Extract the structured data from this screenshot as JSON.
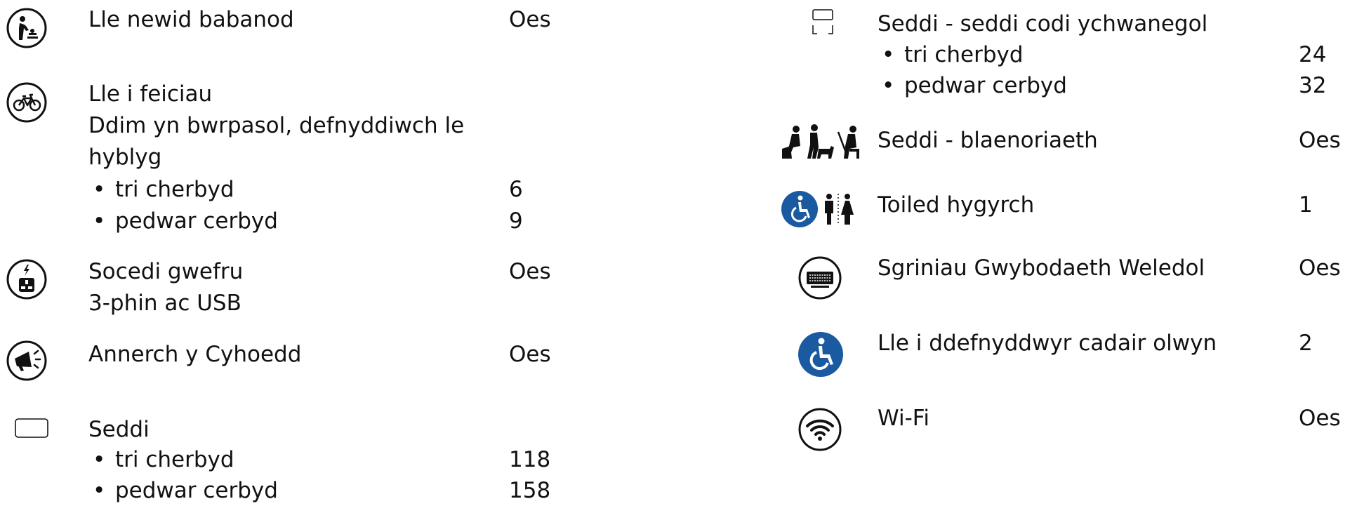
{
  "left": {
    "baby_change": {
      "label": "Lle newid babanod",
      "value": "Oes",
      "icon": "baby-change-icon"
    },
    "bicycle": {
      "label": "Lle i feiciau",
      "desc_line1": "Ddim yn bwrpasol, defnyddiwch le",
      "desc_line2": "hyblyg",
      "items": [
        {
          "label": "tri cherbyd",
          "value": "6"
        },
        {
          "label": "pedwar cerbyd",
          "value": "9"
        }
      ],
      "icon": "bicycle-icon"
    },
    "sockets": {
      "label": "Socedi gwefru",
      "desc": "3-phin ac USB",
      "value": "Oes",
      "icon": "plug-socket-icon"
    },
    "pa": {
      "label": "Annerch y Cyhoedd",
      "value": "Oes",
      "icon": "megaphone-icon"
    },
    "seats": {
      "label": "Seddi",
      "items": [
        {
          "label": "tri cherbyd",
          "value": "118"
        },
        {
          "label": "pedwar cerbyd",
          "value": "158"
        }
      ],
      "icon": "seat-icon"
    }
  },
  "right": {
    "tipup": {
      "label": "Seddi - seddi codi ychwanegol",
      "items": [
        {
          "label": "tri cherbyd",
          "value": "24"
        },
        {
          "label": "pedwar cerbyd",
          "value": "32"
        }
      ],
      "icon": "tip-up-seat-icon"
    },
    "priority": {
      "label": "Seddi - blaenoriaeth",
      "value": "Oes",
      "icon": "priority-seat-icon"
    },
    "toilet": {
      "label": "Toiled hygyrch",
      "value": "1",
      "icon": "accessible-toilet-icon"
    },
    "screens": {
      "label": "Sgriniau Gwybodaeth Weledol",
      "value": "Oes",
      "icon": "info-screen-icon"
    },
    "wheelchair": {
      "label": "Lle i ddefnyddwyr cadair olwyn",
      "value": "2",
      "icon": "wheelchair-icon"
    },
    "wifi": {
      "label": "Wi-Fi",
      "value": "Oes",
      "icon": "wifi-icon"
    }
  },
  "bullet": "•",
  "colors": {
    "accent_blue": "#1a5aa0",
    "text": "#111111"
  }
}
